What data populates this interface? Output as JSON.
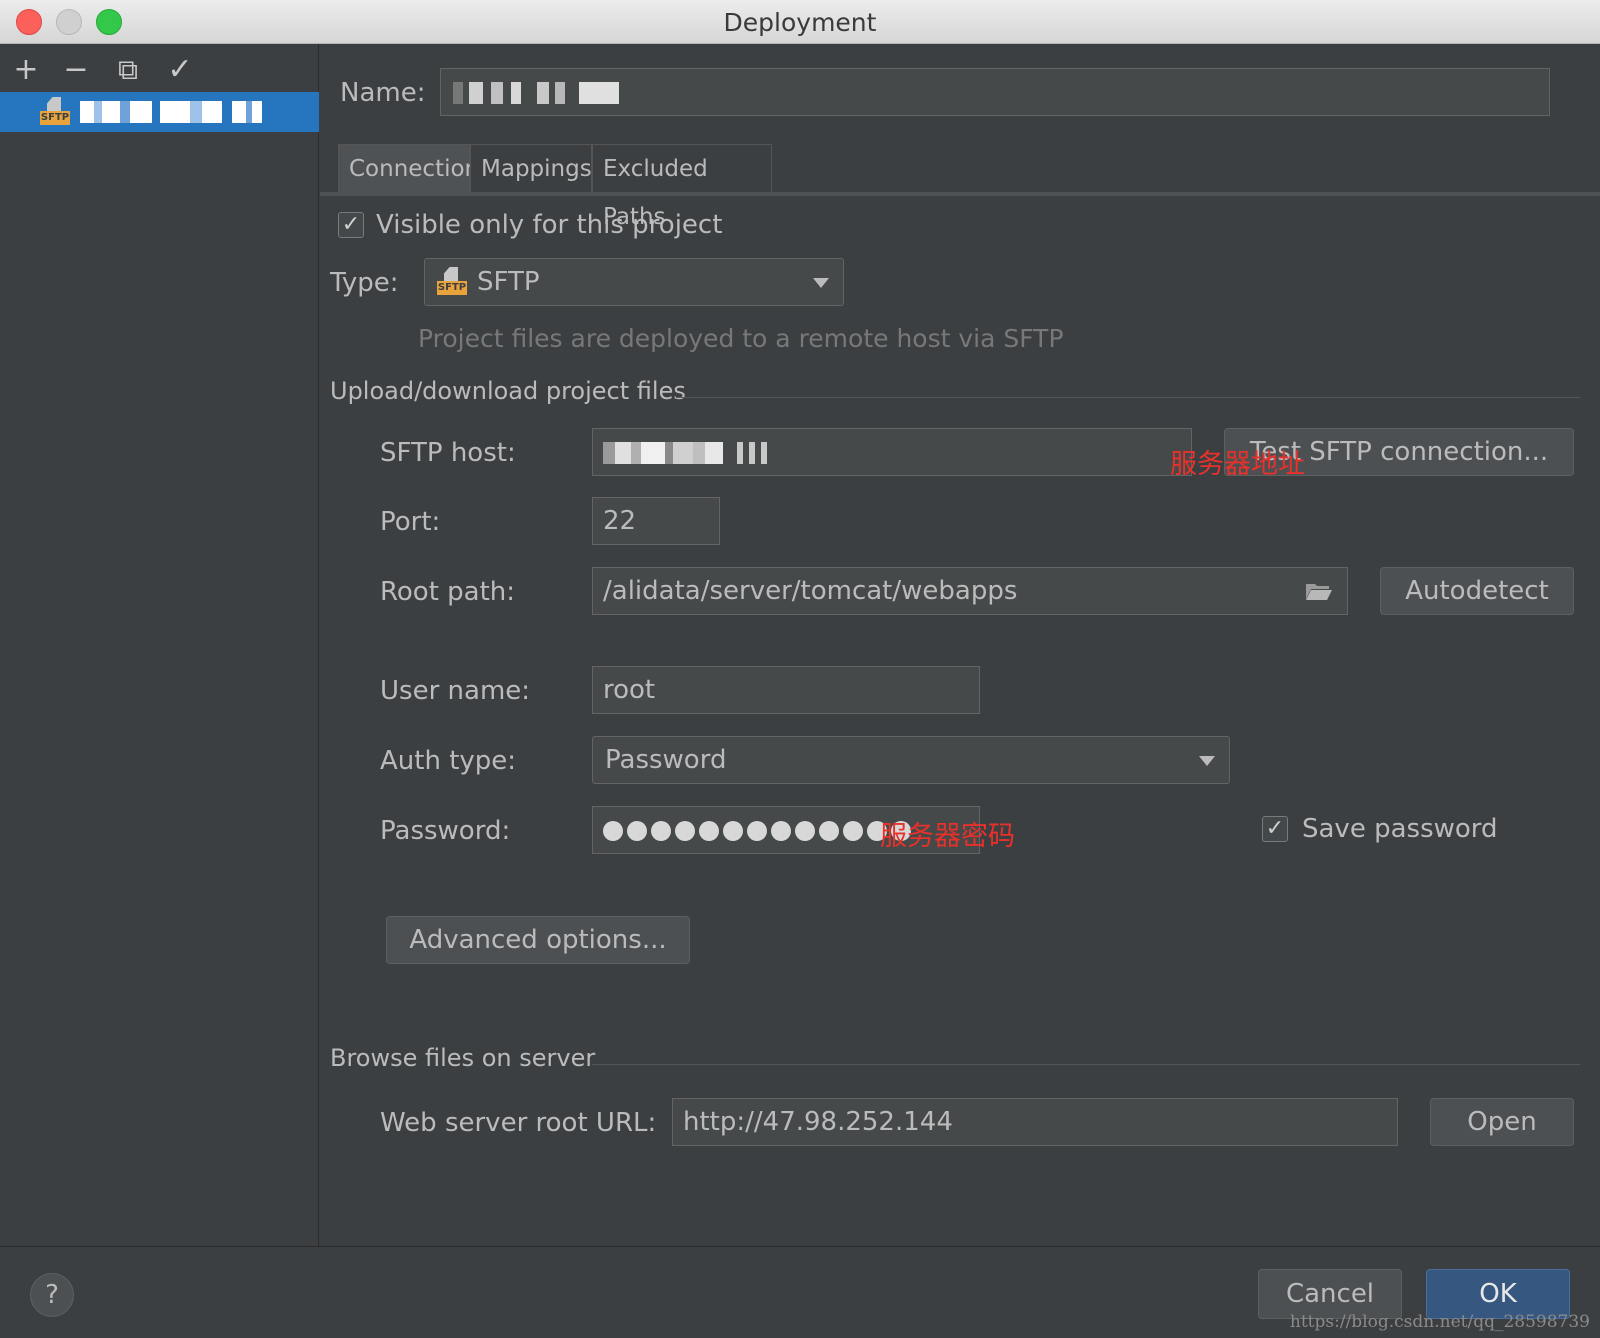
{
  "window": {
    "title": "Deployment"
  },
  "toolbar": {
    "add": "+",
    "remove": "−",
    "copy": "⧉",
    "check": "✓"
  },
  "sidebar": {
    "selected_item_icon_tag": "SFTP"
  },
  "name_field": {
    "label": "Name:"
  },
  "tabs": [
    {
      "label": "Connection",
      "active": true
    },
    {
      "label": "Mappings",
      "active": false
    },
    {
      "label": "Excluded Paths",
      "active": false
    }
  ],
  "connection": {
    "visible_only_label": "Visible only for this project",
    "visible_only_checked": true,
    "type_label": "Type:",
    "type_value": "SFTP",
    "type_icon_tag": "SFTP",
    "type_hint": "Project files are deployed to a remote host via SFTP",
    "upload_section": "Upload/download project files",
    "sftp_host_label": "SFTP host:",
    "sftp_host_note": "服务器地址",
    "test_button": "Test SFTP connection...",
    "port_label": "Port:",
    "port_value": "22",
    "root_path_label": "Root path:",
    "root_path_value": "/alidata/server/tomcat/webapps",
    "autodetect_button": "Autodetect",
    "user_name_label": "User name:",
    "user_name_value": "root",
    "auth_type_label": "Auth type:",
    "auth_type_value": "Password",
    "password_label": "Password:",
    "password_dot_count": 13,
    "password_note": "服务器密码",
    "save_password_label": "Save password",
    "save_password_checked": true,
    "advanced_button": "Advanced options...",
    "browse_section": "Browse files on server",
    "web_root_label": "Web server root URL:",
    "web_root_value": "http://47.98.252.144",
    "open_button": "Open"
  },
  "footer": {
    "help": "?",
    "cancel": "Cancel",
    "ok": "OK",
    "watermark": "https://blog.csdn.net/qq_28598739"
  },
  "colors": {
    "background": "#3c3f41",
    "selection": "#2675bf",
    "ok_button": "#365880",
    "annotation": "#e8312a"
  }
}
